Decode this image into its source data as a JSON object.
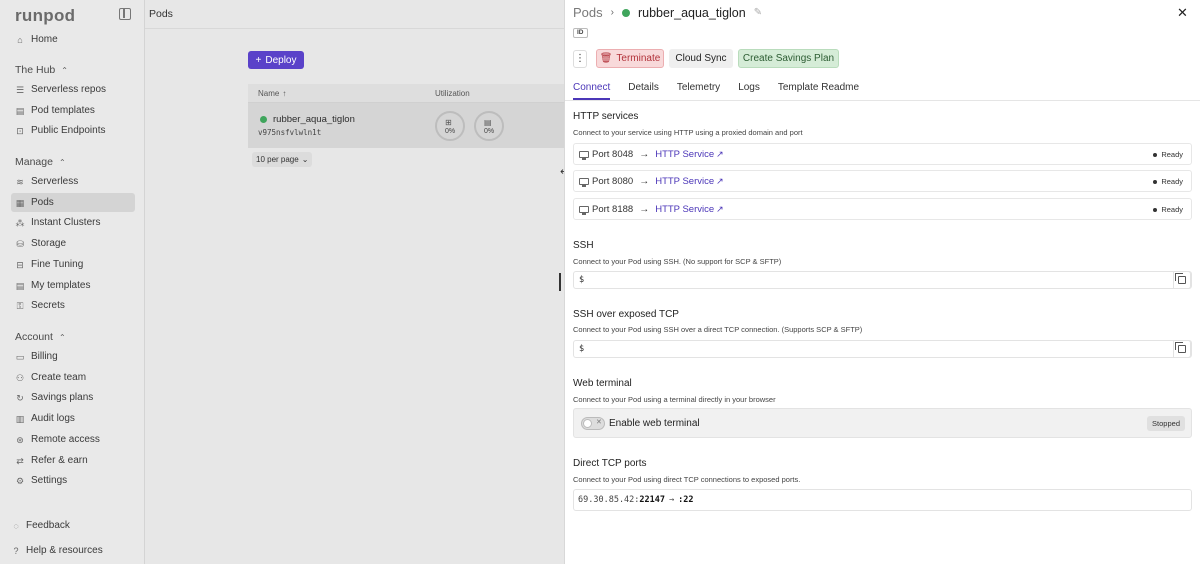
{
  "sidebar": {
    "logo": "runpod",
    "home": "Home",
    "hub_title": "The Hub",
    "hub_items": [
      "Serverless repos",
      "Pod templates",
      "Public Endpoints"
    ],
    "manage_title": "Manage",
    "manage_items": [
      "Serverless",
      "Pods",
      "Instant Clusters",
      "Storage",
      "Fine Tuning",
      "My templates",
      "Secrets"
    ],
    "account_title": "Account",
    "account_items": [
      "Billing",
      "Create team",
      "Savings plans",
      "Audit logs",
      "Remote access",
      "Refer & earn",
      "Settings"
    ],
    "feedback": "Feedback",
    "help": "Help & resources"
  },
  "main": {
    "title": "Pods",
    "deploy": "Deploy",
    "col_name": "Name",
    "col_util": "Utilization",
    "pod_name": "rubber_aqua_tiglon",
    "pod_id": "v975nsfvlwln1t",
    "gauge1": "0%",
    "gauge2": "0%",
    "per_page": "10 per page"
  },
  "panel": {
    "crumb_pods": "Pods",
    "pod_name": "rubber_aqua_tiglon",
    "id_label": "ID",
    "terminate": "Terminate",
    "cloud_sync": "Cloud Sync",
    "savings_plan": "Create Savings Plan",
    "tabs": [
      "Connect",
      "Details",
      "Telemetry",
      "Logs",
      "Template Readme"
    ],
    "http": {
      "title": "HTTP services",
      "desc": "Connect to your service using HTTP using a proxied domain and port",
      "services": [
        {
          "port": "Port 8048",
          "link": "HTTP Service",
          "status": "Ready"
        },
        {
          "port": "Port 8080",
          "link": "HTTP Service",
          "status": "Ready"
        },
        {
          "port": "Port 8188",
          "link": "HTTP Service",
          "status": "Ready"
        }
      ]
    },
    "ssh": {
      "title": "SSH",
      "desc": "Connect to your Pod using SSH. (No support for SCP & SFTP)",
      "prompt": "$"
    },
    "ssh_tcp": {
      "title": "SSH over exposed TCP",
      "desc": "Connect to your Pod using SSH over a direct TCP connection. (Supports SCP & SFTP)",
      "prompt": "$"
    },
    "web_terminal": {
      "title": "Web terminal",
      "desc": "Connect to your Pod using a terminal directly in your browser",
      "toggle_label": "Enable web terminal",
      "status": "Stopped"
    },
    "direct_tcp": {
      "title": "Direct TCP ports",
      "desc": "Connect to your Pod using direct TCP connections to exposed ports.",
      "ip": "69.30.85.42:",
      "external_port": "22147",
      "arrow": "→",
      "internal_port": ":22"
    }
  }
}
